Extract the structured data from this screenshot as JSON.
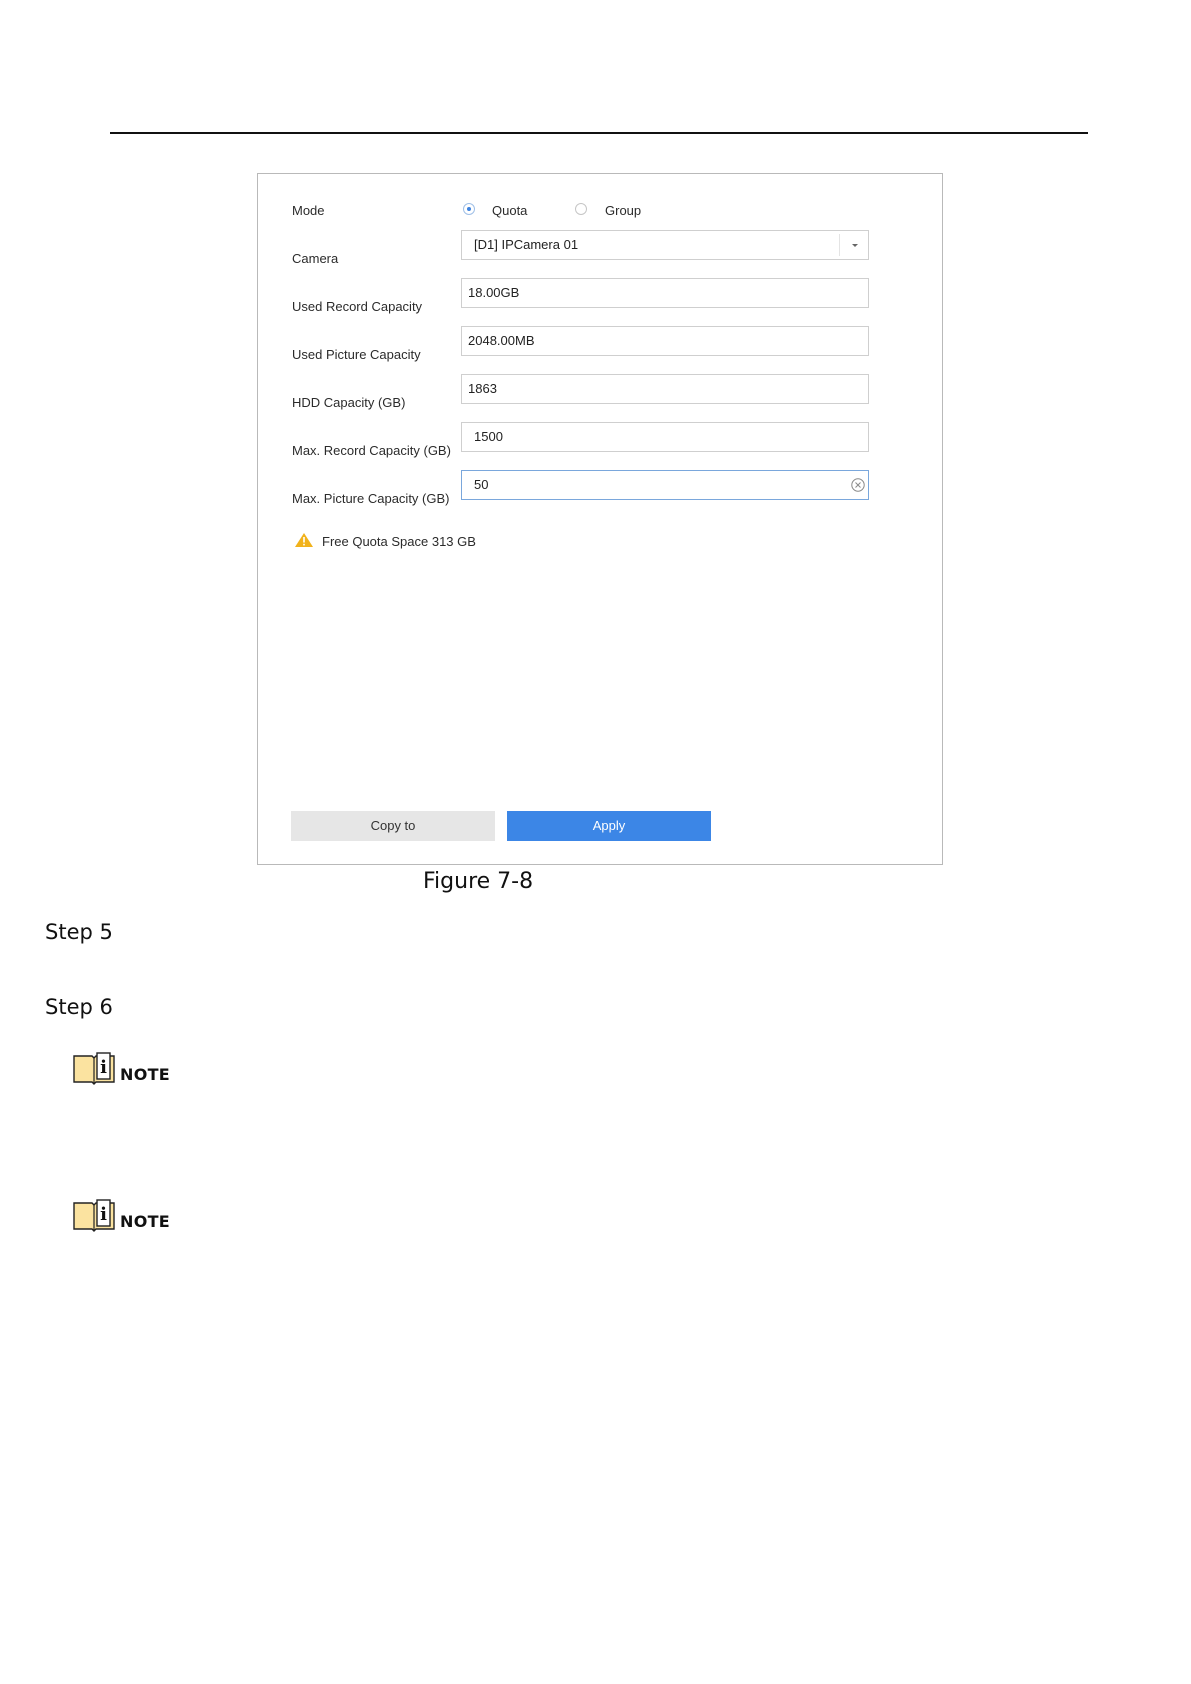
{
  "form": {
    "mode_label": "Mode",
    "mode_options": [
      "Quota",
      "Group"
    ],
    "mode_selected": "Quota",
    "camera_label": "Camera",
    "camera_value": "[D1] IPCamera 01",
    "used_record_label": "Used Record Capacity",
    "used_record_value": "18.00GB",
    "used_picture_label": "Used Picture Capacity",
    "used_picture_value": "2048.00MB",
    "hdd_label": "HDD Capacity (GB)",
    "hdd_value": "1863",
    "max_record_label": "Max. Record Capacity (GB)",
    "max_record_value": "1500",
    "max_picture_label": "Max. Picture Capacity (GB)",
    "max_picture_value": "50",
    "free_quota_text": "Free Quota Space 313 GB",
    "copy_to_label": "Copy to",
    "apply_label": "Apply"
  },
  "document": {
    "caption": "Figure 7-8",
    "step5": "Step 5",
    "step6": "Step 6",
    "note_label": "NOTE"
  },
  "colors": {
    "apply_button": "#3c86e6",
    "radio_accent": "#3d83e0",
    "warning": "#f1b21b"
  },
  "icons": [
    "radio-checked-icon",
    "radio-unchecked-icon",
    "chevron-down-icon",
    "clear-icon",
    "warning-icon",
    "note-book-icon"
  ]
}
